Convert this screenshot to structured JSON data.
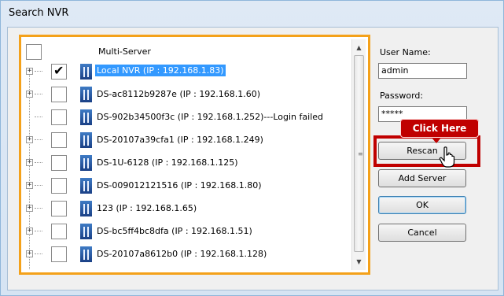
{
  "window": {
    "title": "Search NVR"
  },
  "tree": {
    "root_label": "Multi-Server",
    "items": [
      {
        "label": "Local NVR (IP : 192.168.1.83)",
        "checked": true,
        "selected": true,
        "expandable": true
      },
      {
        "label": "DS-ac8112b9287e (IP : 192.168.1.60)",
        "checked": false,
        "selected": false,
        "expandable": true
      },
      {
        "label": "DS-902b34500f3c (IP : 192.168.1.252)---Login failed",
        "checked": false,
        "selected": false,
        "expandable": false
      },
      {
        "label": "DS-20107a39cfa1 (IP : 192.168.1.249)",
        "checked": false,
        "selected": false,
        "expandable": true
      },
      {
        "label": "DS-1U-6128 (IP : 192.168.1.125)",
        "checked": false,
        "selected": false,
        "expandable": true
      },
      {
        "label": "DS-009012121516 (IP : 192.168.1.80)",
        "checked": false,
        "selected": false,
        "expandable": true
      },
      {
        "label": "123 (IP : 192.168.1.65)",
        "checked": false,
        "selected": false,
        "expandable": true
      },
      {
        "label": "DS-bc5ff4bc8dfa (IP : 192.168.1.51)",
        "checked": false,
        "selected": false,
        "expandable": true
      },
      {
        "label": "DS-20107a8612b0 (IP : 192.168.1.128)",
        "checked": false,
        "selected": false,
        "expandable": true
      }
    ]
  },
  "form": {
    "username_label": "User Name:",
    "username_value": "admin",
    "password_label": "Password:",
    "password_value": "*****"
  },
  "buttons": {
    "rescan": "Rescan",
    "add_server": "Add Server",
    "ok": "OK",
    "cancel": "Cancel"
  },
  "annotation": {
    "callout": "Click Here"
  },
  "colors": {
    "highlight_frame": "#f4a11a",
    "callout": "#c00000",
    "selection": "#3399ff"
  }
}
